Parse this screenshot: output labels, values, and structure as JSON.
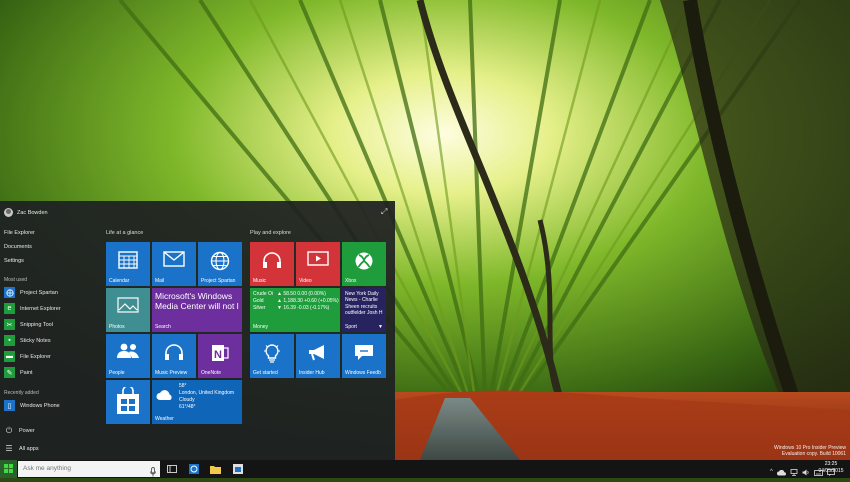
{
  "start_menu": {
    "user_name": "Zac Bowden",
    "places": [
      {
        "label": "File Explorer"
      },
      {
        "label": "Documents"
      },
      {
        "label": "Settings"
      }
    ],
    "most_used_heading": "Most used",
    "most_used": [
      {
        "label": "Project Spartan",
        "icon": "globe-icon",
        "color": "#1a73c8"
      },
      {
        "label": "Internet Explorer",
        "icon": "ie-icon",
        "color": "#1f9c3c"
      },
      {
        "label": "Snipping Tool",
        "icon": "scissors-icon",
        "color": "#1f9c3c"
      },
      {
        "label": "Sticky Notes",
        "icon": "note-icon",
        "color": "#1f9c3c"
      },
      {
        "label": "File Explorer",
        "icon": "folder-icon",
        "color": "#1f9c3c"
      },
      {
        "label": "Paint",
        "icon": "paint-icon",
        "color": "#1f9c3c"
      }
    ],
    "recently_added_heading": "Recently added",
    "recently_added": [
      {
        "label": "Windows Phone",
        "icon": "phone-icon",
        "color": "#1a73c8"
      }
    ],
    "power_label": "Power",
    "all_apps_label": "All apps",
    "groups": {
      "life_at_a_glance": "Life at a glance",
      "play_and_explore": "Play and explore"
    },
    "tiles": {
      "calendar": "Calendar",
      "mail": "Mail",
      "project_spartan": "Project Spartan",
      "photos": "Photos",
      "search": {
        "label": "Search",
        "headline": "Microsoft's Windows Media Center will not l"
      },
      "people": "People",
      "music_preview": "Music Preview",
      "onenote": "OneNote",
      "weather": {
        "label": "Weather",
        "temp": "58°",
        "location": "London, United Kingdom",
        "condition": "Cloudy",
        "range": "61°/48°"
      },
      "music": "Music",
      "video": "Video",
      "xbox": "Xbox",
      "money": {
        "label": "Money",
        "rows": [
          {
            "name": "Crude Oi",
            "value": "▲ 58.50 0.00 (0.00%)"
          },
          {
            "name": "Gold",
            "value": "▲ 1,188.30 +0.60 (+0.05%)"
          },
          {
            "name": "Silver",
            "value": "▼ 16.39 -0.03 (-0.17%)"
          }
        ]
      },
      "sport": {
        "label": "Sport",
        "headline": "New York Daily News - Charlie Sheen recruits outfielder Josh H"
      },
      "get_started": "Get started",
      "insider_hub": "Insider Hub",
      "windows_feedback": "Windows Feedb"
    }
  },
  "desktop": {
    "watermark_line1": "Windows 10 Pro Insider Preview",
    "watermark_line2": "Evaluation copy. Build 10061"
  },
  "taskbar": {
    "search_placeholder": "Ask me anything",
    "time": "23:25",
    "date": "04/05/2015"
  }
}
